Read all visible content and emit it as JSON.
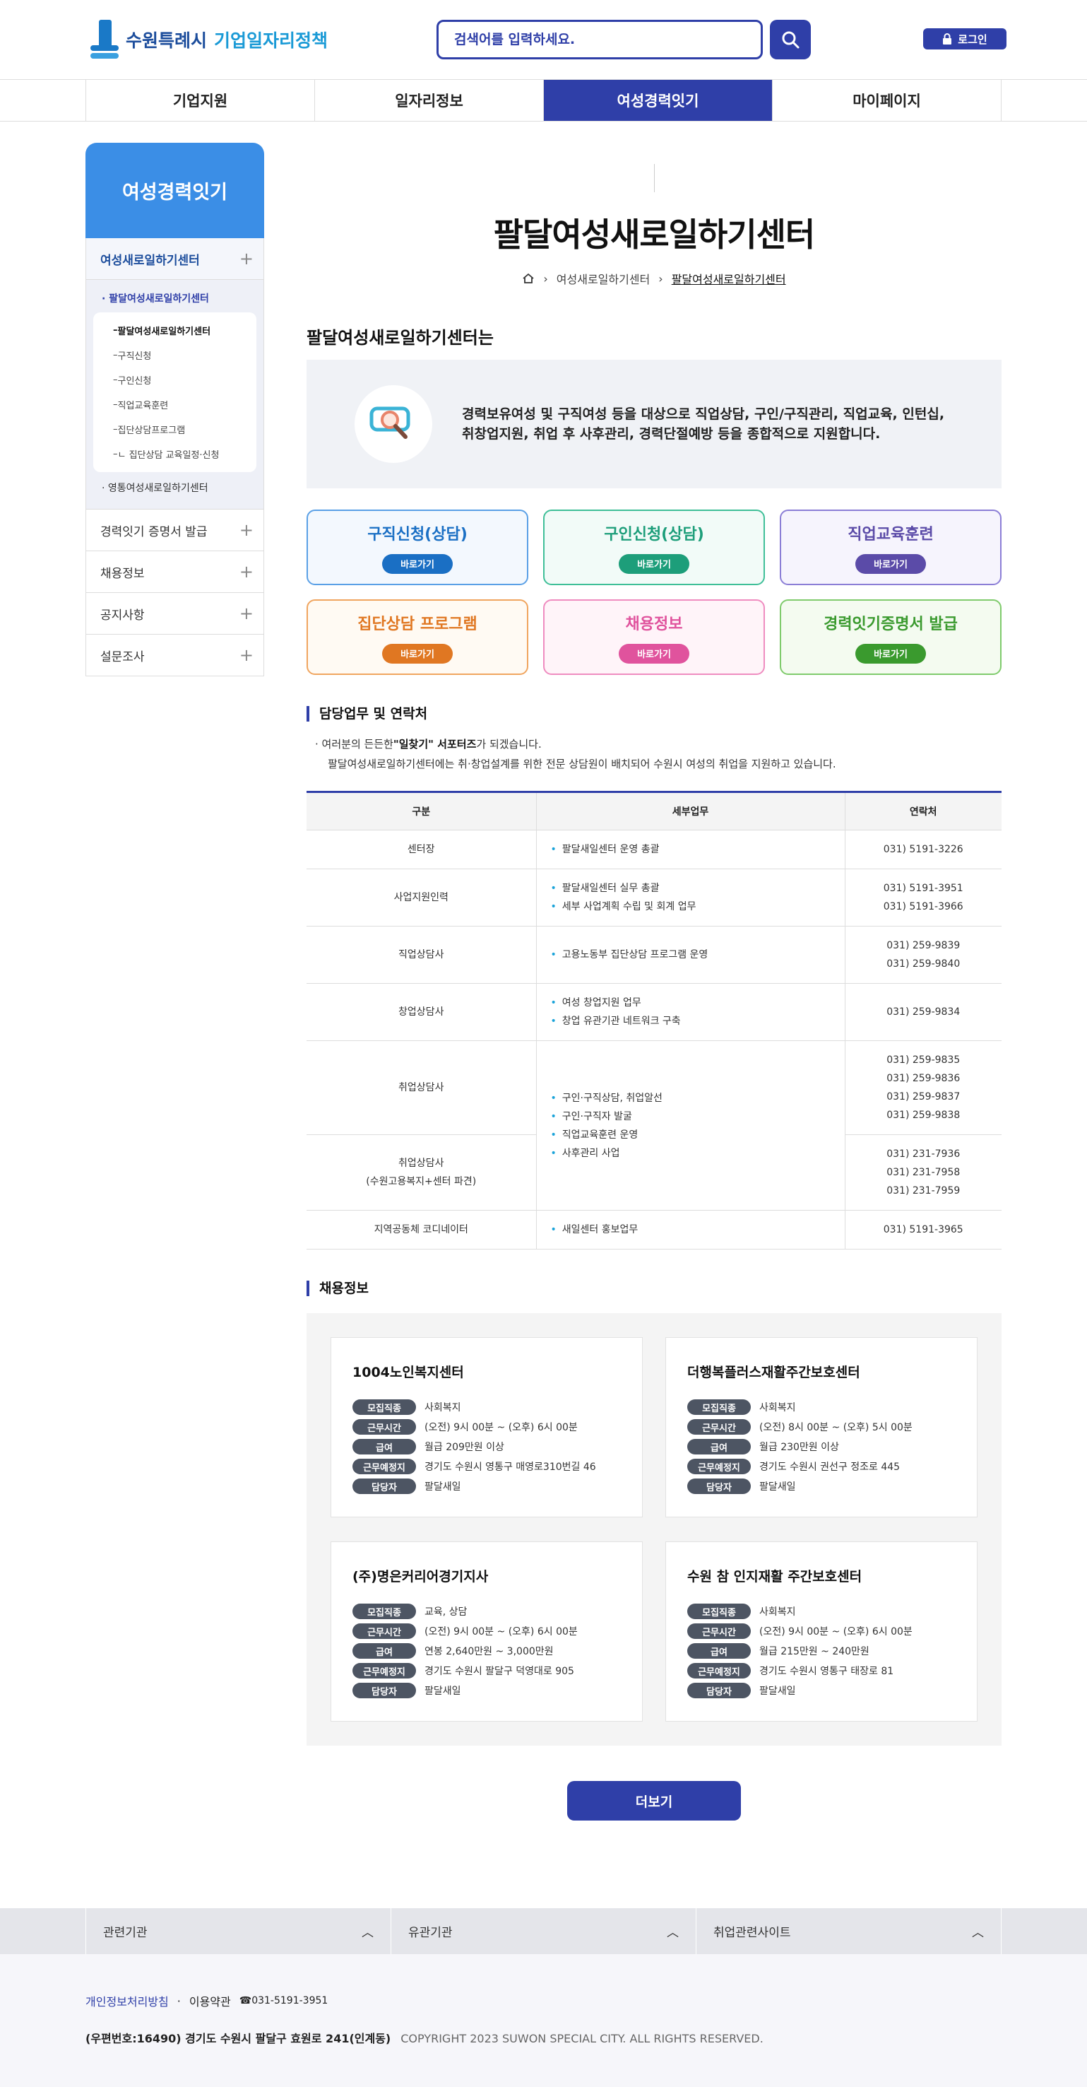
{
  "header": {
    "logo_city": "수원특례시",
    "logo_title": "기업일자리정책",
    "search_placeholder": "검색어를 입력하세요.",
    "login_label": "로그인"
  },
  "gnb": [
    "기업지원",
    "일자리정보",
    "여성경력잇기",
    "마이페이지"
  ],
  "lnb": {
    "title": "여성경력잇기",
    "section1": "여성새로일하기센터",
    "sub_active": "팔달여성새로일하기센터",
    "sub_items": [
      "팔달여성새로일하기센터",
      "구직신청",
      "구인신청",
      "직업교육훈련",
      "집단상담프로그램",
      "ㄴ 집단상담 교육일정·신청"
    ],
    "sub_other": "영통여성새로일하기센터",
    "items": [
      "경력잇기 증명서 발급",
      "채용정보",
      "공지사항",
      "설문조사"
    ]
  },
  "page": {
    "title": "팔달여성새로일하기센터",
    "breadcrumb_mid": "여성새로일하기센터",
    "breadcrumb_cur": "팔달여성새로일하기센터",
    "intro_heading": "팔달여성새로일하기센터는",
    "intro_text_1": "경력보유여성 및 구직여성 등을 대상으로 직업상담, 구인/구직관리, 직업교육, 인턴십,",
    "intro_text_2": "취창업지원, 취업 후 사후관리, 경력단절예방 등을 종합적으로 지원합니다."
  },
  "quick": [
    {
      "title": "구직신청(상담)",
      "btn": "바로가기",
      "color": "#1a6fc4",
      "bg": "#f3f8fe",
      "border": "#5aa0e6"
    },
    {
      "title": "구인신청(상담)",
      "btn": "바로가기",
      "color": "#1d9e7a",
      "bg": "#f2fbf8",
      "border": "#3fbf98"
    },
    {
      "title": "직업교육훈련",
      "btn": "바로가기",
      "color": "#5b4ba8",
      "bg": "#f6f4fd",
      "border": "#8b7ed6"
    },
    {
      "title": "집단상담 프로그램",
      "btn": "바로가기",
      "color": "#e07722",
      "bg": "#fffaf3",
      "border": "#f0a55f"
    },
    {
      "title": "채용정보",
      "btn": "바로가기",
      "color": "#e0539d",
      "bg": "#fff4f9",
      "border": "#ef8cc0"
    },
    {
      "title": "경력잇기증명서 발급",
      "btn": "바로가기",
      "color": "#3a9a2e",
      "bg": "#f4fbf0",
      "border": "#7fcb6c"
    }
  ],
  "contact": {
    "heading": "담당업무 및 연락처",
    "desc_pre": "여러분의 든든한",
    "desc_bold": "\"일찾기\" 서포터즈",
    "desc_post": "가 되겠습니다.",
    "desc_line2": "팔달여성새로일하기센터에는 취·창업설계를 위한 전문 상담원이 배치되어 수원시 여성의 취업을 지원하고 있습니다.",
    "headers": [
      "구분",
      "세부업무",
      "연락처"
    ],
    "rows": [
      {
        "cat": "센터장",
        "tasks": [
          "팔달새일센터 운영 총괄"
        ],
        "phones": [
          "031) 5191-3226"
        ]
      },
      {
        "cat": "사업지원인력",
        "tasks": [
          "팔달새일센터 실무 총괄",
          "세부 사업계획 수립 및 회계 업무"
        ],
        "phones": [
          "031) 5191-3951",
          "031) 5191-3966"
        ]
      },
      {
        "cat": "직업상담사",
        "tasks": [
          "고용노동부 집단상담 프로그램 운영"
        ],
        "phones": [
          "031) 259-9839",
          "031) 259-9840"
        ]
      },
      {
        "cat": "창업상담사",
        "tasks": [
          "여성 창업지원 업무",
          "창업 유관기관 네트워크 구축"
        ],
        "phones": [
          "031) 259-9834"
        ]
      },
      {
        "cat": "취업상담사",
        "tasks": [
          "구인·구직상담, 취업알선",
          "구인·구직자 발굴",
          "직업교육훈련 운영",
          "사후관리 사업"
        ],
        "phones": [
          "031) 259-9835",
          "031) 259-9836",
          "031) 259-9837",
          "031) 259-9838"
        ]
      },
      {
        "cat": "취업상담사",
        "cat2": "(수원고용복지+센터 파견)",
        "phones": [
          "031) 231-7936",
          "031) 231-7958",
          "031) 231-7959"
        ]
      },
      {
        "cat": "지역공동체 코디네이터",
        "tasks": [
          "새일센터 홍보업무"
        ],
        "phones": [
          "031) 5191-3965"
        ]
      }
    ]
  },
  "jobs": {
    "heading": "채용정보",
    "labels": [
      "모집직종",
      "근무시간",
      "급여",
      "근무예정지",
      "담당자"
    ],
    "items": [
      {
        "name": "1004노인복지센터",
        "values": [
          "사회복지",
          "(오전) 9시 00분 ~ (오후) 6시 00분",
          "월급 209만원 이상",
          "경기도 수원시 영통구 매영로310번길 46",
          "팔달새일"
        ]
      },
      {
        "name": "더행복플러스재활주간보호센터",
        "values": [
          "사회복지",
          "(오전) 8시 00분 ~ (오후) 5시 00분",
          "월급 230만원 이상",
          "경기도 수원시 권선구 정조로 445",
          "팔달새일"
        ]
      },
      {
        "name": "(주)명은커리어경기지사",
        "values": [
          "교육, 상담",
          "(오전) 9시 00분 ~ (오후) 6시 00분",
          "연봉 2,640만원 ~ 3,000만원",
          "경기도 수원시 팔달구 덕영대로 905",
          "팔달새일"
        ]
      },
      {
        "name": "수원 참 인지재활 주간보호센터",
        "values": [
          "사회복지",
          "(오전) 9시 00분 ~ (오후) 6시 00분",
          "월급 215만원 ~ 240만원",
          "경기도 수원시 영통구 태장로 81",
          "팔달새일"
        ]
      }
    ],
    "more_label": "더보기"
  },
  "footer": {
    "menus": [
      "관련기관",
      "유관기관",
      "취업관련사이트"
    ],
    "privacy": "개인정보처리방침",
    "terms": "이용약관",
    "phone": "031-5191-3951",
    "address": "(우편번호:16490) 경기도 수원시 팔달구 효원로 241(인계동)",
    "copyright": "COPYRIGHT 2023 SUWON SPECIAL CITY. ALL RIGHTS RESERVED."
  }
}
